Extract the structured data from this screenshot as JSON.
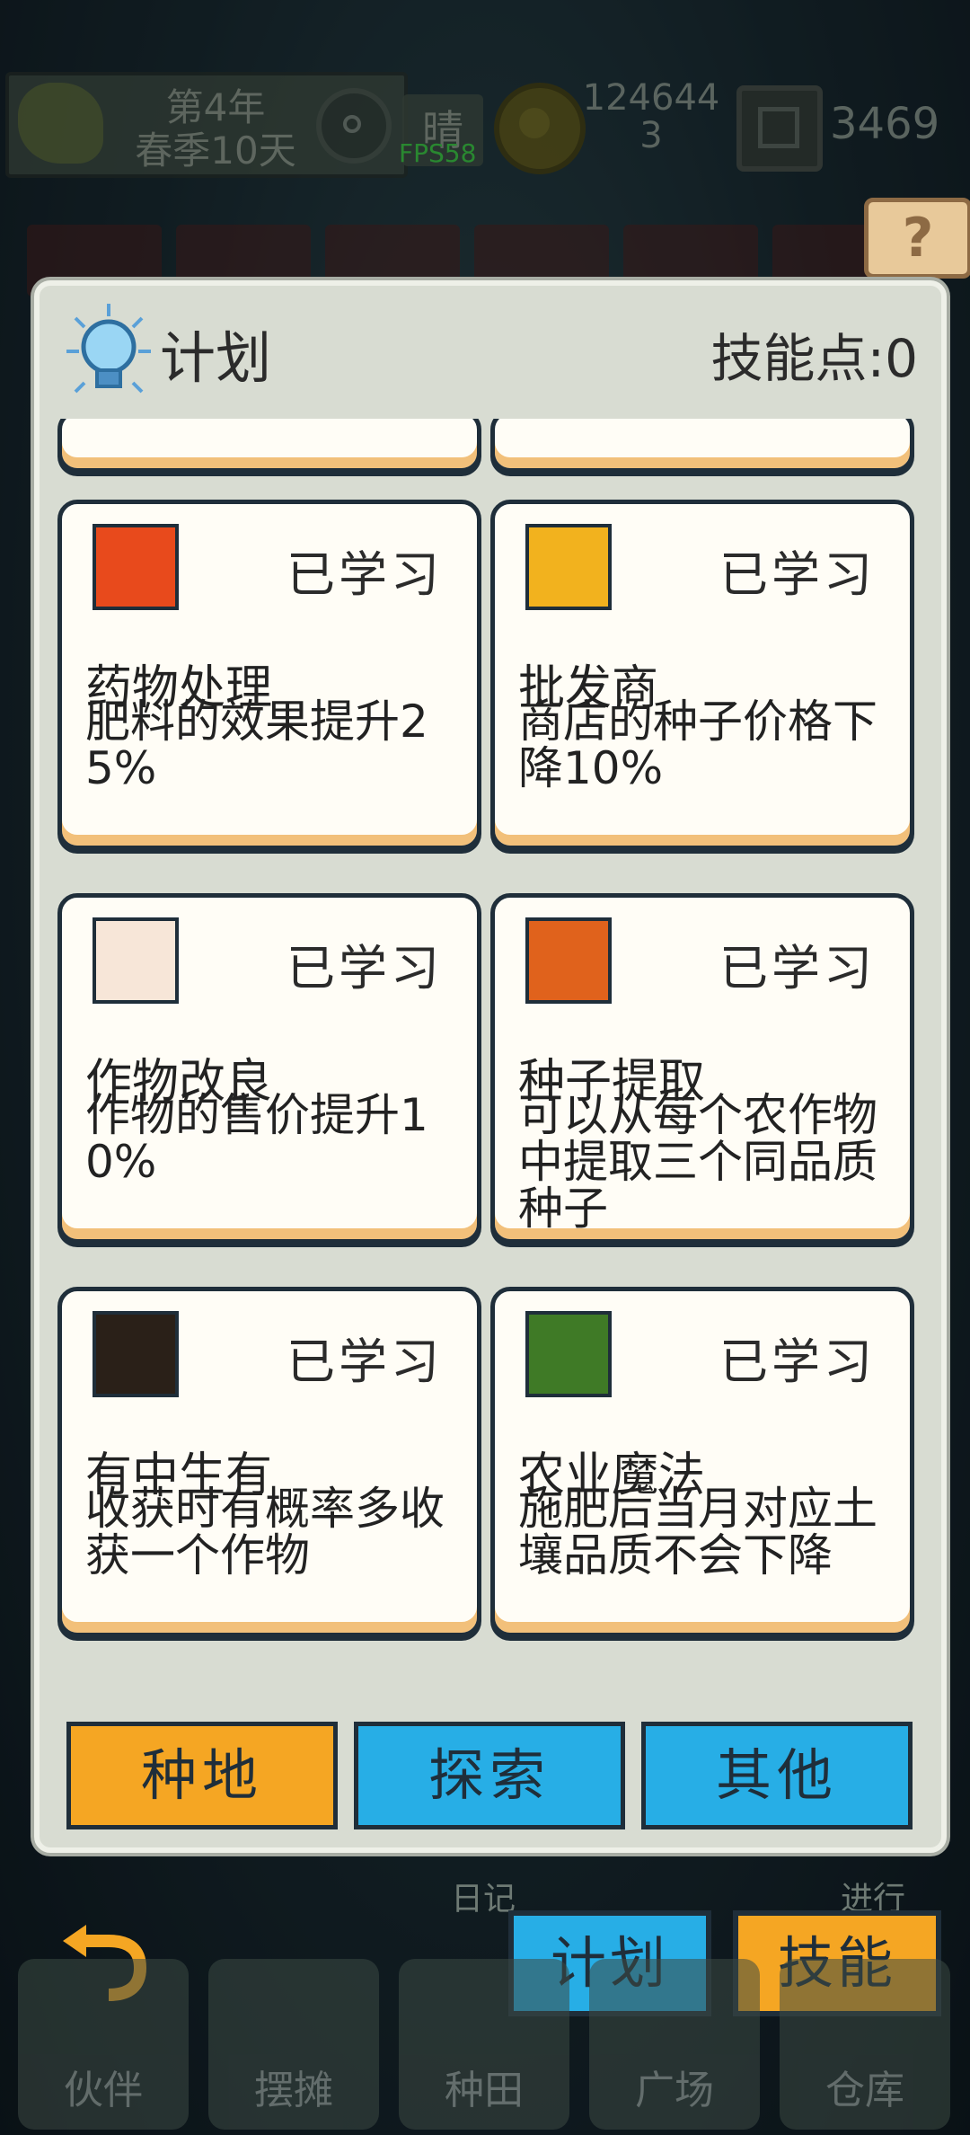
{
  "hud": {
    "year": "第4年",
    "day": "春季10天",
    "weather": "晴",
    "fps": "FPS58",
    "coins_line1": "124644",
    "coins_line2": "3",
    "gems": "3469",
    "help": "?"
  },
  "panel": {
    "title": "计划",
    "skill_points": "技能点:0"
  },
  "skills": [
    {
      "status": "已学习",
      "name": "药物处理",
      "desc": "肥料的效果提升25%",
      "icon": "fertilizer-potion-icon",
      "icon_color": "#e84a1c"
    },
    {
      "status": "已学习",
      "name": "批发商",
      "desc": "商店的种子价格下降10%",
      "icon": "seed-bag-icon",
      "icon_color": "#f2b21e"
    },
    {
      "status": "已学习",
      "name": "作物改良",
      "desc": "作物的售价提升10%",
      "icon": "sprout-icon",
      "icon_color": "#f7e6d8"
    },
    {
      "status": "已学习",
      "name": "种子提取",
      "desc": "可以从每个农作物中提取三个同品质种子",
      "icon": "seed-extract-icon",
      "icon_color": "#e0621c"
    },
    {
      "status": "已学习",
      "name": "有中生有",
      "desc": "收获时有概率多收获一个作物",
      "icon": "sparkle-box-icon",
      "icon_color": "#2a2018"
    },
    {
      "status": "已学习",
      "name": "农业魔法",
      "desc": "施肥后当月对应土壤品质不会下降",
      "icon": "magic-flask-icon",
      "icon_color": "#3f7a26"
    }
  ],
  "tabs": [
    {
      "label": "种地",
      "color": "#f5a623"
    },
    {
      "label": "探索",
      "color": "#27aee6"
    },
    {
      "label": "其他",
      "color": "#27aee6"
    }
  ],
  "bottom": {
    "plan": "计划",
    "skill": "技能",
    "diary": "日记",
    "progress": "进行"
  },
  "nav": [
    {
      "label": "伙伴"
    },
    {
      "label": "摆摊"
    },
    {
      "label": "种田"
    },
    {
      "label": "广场"
    },
    {
      "label": "仓库"
    }
  ],
  "colors": {
    "accent_orange": "#f5a623",
    "accent_blue": "#27aee6",
    "card_border": "#1f2e3a"
  }
}
